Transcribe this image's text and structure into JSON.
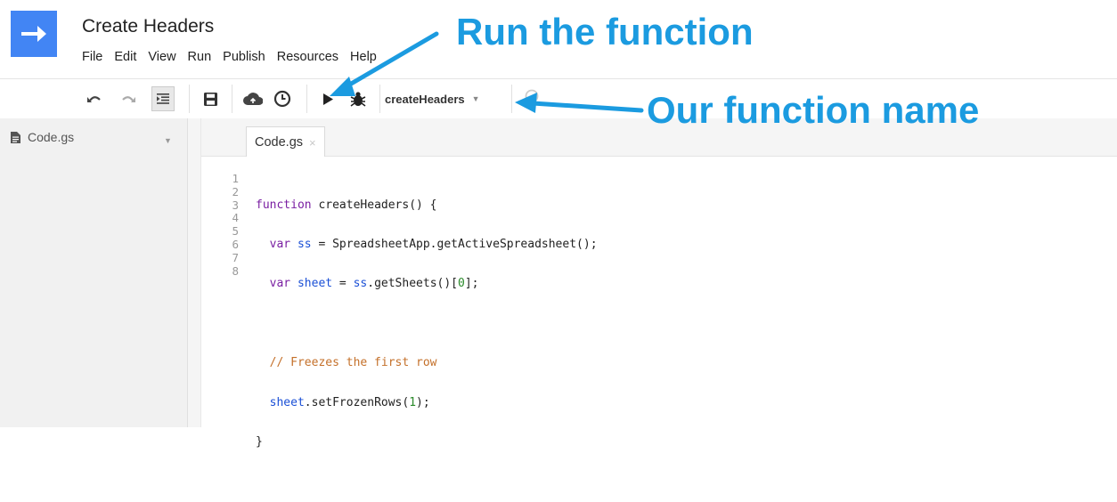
{
  "app": {
    "title": "Create Headers"
  },
  "menu": [
    "File",
    "Edit",
    "View",
    "Run",
    "Publish",
    "Resources",
    "Help"
  ],
  "toolbar": {
    "function_name": "createHeaders"
  },
  "sidebar": {
    "file_name": "Code.gs"
  },
  "tab": {
    "label": "Code.gs",
    "close": "×"
  },
  "editor": {
    "line_numbers": [
      "1",
      "2",
      "3",
      "4",
      "5",
      "6",
      "7",
      "8"
    ],
    "lines": [
      "function createHeaders() {",
      "  var ss = SpreadsheetApp.getActiveSpreadsheet();",
      "  var sheet = ss.getSheets()[0];",
      "",
      "  // Freezes the first row",
      "  sheet.setFrozenRows(1);",
      "}",
      ""
    ]
  },
  "annotations": {
    "run": "Run the function",
    "name": "Our function name"
  },
  "colors": {
    "annotation": "#1b9be0",
    "logo": "#4285f4"
  }
}
